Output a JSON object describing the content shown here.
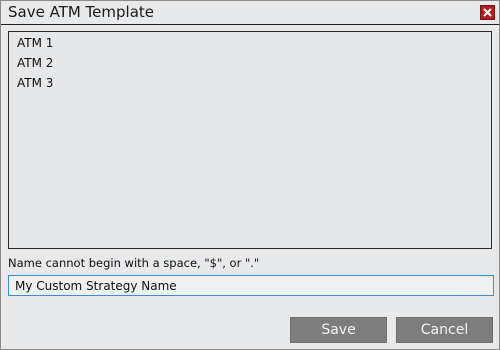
{
  "window": {
    "title": "Save ATM Template",
    "close_icon": "close-x-icon",
    "close_icon_color": "#b01e1e"
  },
  "template_list": {
    "items": [
      {
        "label": "ATM 1"
      },
      {
        "label": "ATM 2"
      },
      {
        "label": "ATM 3"
      }
    ]
  },
  "name_field": {
    "hint": "Name cannot begin with a space, \"$\", or \".\"",
    "value": "My Custom Strategy Name",
    "focus_color": "#3c8dd4"
  },
  "buttons": {
    "save_label": "Save",
    "cancel_label": "Cancel",
    "color": "#7d7d7d"
  }
}
